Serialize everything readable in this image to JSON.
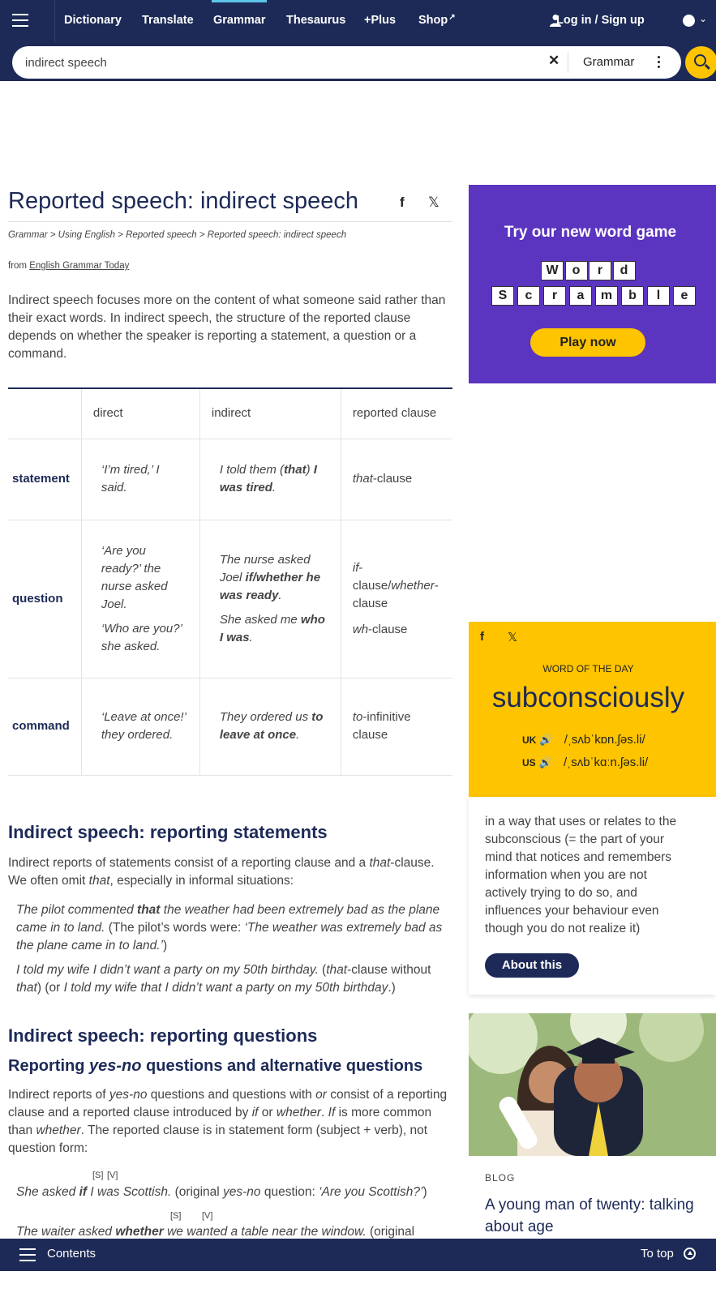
{
  "nav": {
    "items": [
      {
        "label": "Dictionary"
      },
      {
        "label": "Translate"
      },
      {
        "label": "Grammar"
      },
      {
        "label": "Thesaurus"
      },
      {
        "label": "+Plus"
      },
      {
        "label": "Shop"
      }
    ],
    "active": "Grammar",
    "login": "Log in / Sign up"
  },
  "search": {
    "value": "indirect speech",
    "dictionary": "Grammar"
  },
  "article": {
    "title": "Reported speech: indirect speech",
    "breadcrumb": "Grammar > Using English > Reported speech > Reported speech: indirect speech",
    "from_prefix": "from",
    "from_link": "English Grammar Today",
    "intro": "Indirect speech focuses more on the content of what someone said rather than their exact words. In indirect speech, the structure of the reported clause depends on whether the speaker is reporting a statement, a question or a command.",
    "table": {
      "headers": [
        "",
        "direct",
        "indirect",
        "reported clause"
      ],
      "rows": [
        {
          "type": "statement",
          "direct": [
            "‘I’m tired,’ I said."
          ],
          "indirect_pre": "I told them (",
          "indirect_bold1": "that",
          "indirect_mid": ") ",
          "indirect_bold2": "I was tired",
          "indirect_post": ".",
          "reported_1_it": "that",
          "reported_1": "-clause"
        },
        {
          "type": "question",
          "direct": [
            "‘Are you ready?’ the nurse asked Joel.",
            "‘Who are you?’ she asked."
          ],
          "indirect_a_pre": "The nurse asked Joel ",
          "indirect_a_bold": "if/whether he was ready",
          "indirect_a_post": ".",
          "indirect_b_pre": "She asked me ",
          "indirect_b_bold": "who I was",
          "indirect_b_post": ".",
          "reported_1_it": "if",
          "reported_1": "-clause/",
          "reported_1_it2": "whether",
          "reported_1_end": "-clause",
          "reported_2_it": "wh",
          "reported_2": "-clause"
        },
        {
          "type": "command",
          "direct": [
            "‘Leave at once!’ they ordered."
          ],
          "indirect_pre": "They ordered us ",
          "indirect_bold": "to leave at once",
          "indirect_post": ".",
          "reported_1_it": "to",
          "reported_1": "-infinitive clause"
        }
      ]
    },
    "statements": {
      "heading": "Indirect speech: reporting statements",
      "para_1": "Indirect reports of statements consist of a reporting clause and a ",
      "para_it1": "that",
      "para_2": "-clause. We often omit ",
      "para_it2": "that",
      "para_3": ", especially in informal situations:",
      "ex1_it1": "The pilot commented ",
      "ex1_b": "that",
      "ex1_it2": " the weather had been extremely bad as the plane came in to land.",
      "ex1_note1": " (The pilot’s words were: ",
      "ex1_it3": "‘The weather was extremely bad as the plane came in to land.’",
      "ex1_note2": ")",
      "ex2_it1": "I told my wife I didn’t want a party on my 50th birthday.",
      "ex2_n1": " (",
      "ex2_it2": "that",
      "ex2_n2": "-clause without ",
      "ex2_it3": "that",
      "ex2_n3": ") (or ",
      "ex2_it4": "I told my wife that I didn’t want a party on my 50th birthday",
      "ex2_n4": ".)"
    },
    "questions": {
      "heading": "Indirect speech: reporting questions",
      "subheading_1": "Reporting ",
      "subheading_it": "yes-no",
      "subheading_2": " questions and alternative questions",
      "p1": "Indirect reports of ",
      "p_it1": "yes-no",
      "p2": " questions and questions with ",
      "p_it2": "or",
      "p3": " consist of a reporting clause and a reported clause introduced by ",
      "p_it3": "if",
      "p4": " or ",
      "p_it4": "whether",
      "p5": ". ",
      "p_it5": "If",
      "p6": " is more common than ",
      "p_it6": "whether",
      "p7": ". The reported clause is in statement form (subject + verb), not question form:",
      "sv_s": "[S]",
      "sv_v": "[V]",
      "ex1_it1": "She asked ",
      "ex1_b": "if",
      "ex1_it2": " I was Scottish.",
      "ex1_n1": " (original ",
      "ex1_it3": "yes-no",
      "ex1_n2": " question: ",
      "ex1_it4": "‘Are you Scottish?’",
      "ex1_n3": ")",
      "ex2_it1": "The waiter asked ",
      "ex2_b": "whether",
      "ex2_it2": " we wanted a table near the window.",
      "ex2_n1": " (original"
    }
  },
  "promo": {
    "title": "Try our new word game",
    "word1": [
      "W",
      "o",
      "r",
      "d"
    ],
    "word2": [
      "S",
      "c",
      "r",
      "a",
      "m",
      "b",
      "l",
      "e"
    ],
    "button": "Play now",
    "bg": "#5b34c0"
  },
  "wotd": {
    "label": "WORD OF THE DAY",
    "word": "subconsciously",
    "uk_label": "UK",
    "uk_pron": "/ˌsʌbˈkɒn.ʃəs.li/",
    "us_label": "US",
    "us_pron": "/ˌsʌbˈkɑːn.ʃəs.li/",
    "definition": "in a way that uses or relates to the subconscious (= the part of your mind that notices and remembers information when you are not actively trying to do so, and influences your behaviour even though you do not realize it)",
    "button": "About this",
    "bg": "#fec400"
  },
  "blog": {
    "kicker": "BLOG",
    "title": "A young man of twenty: talking about age"
  },
  "bottom": {
    "contents": "Contents",
    "to_top": "To top"
  },
  "colors": {
    "brand_navy": "#1d2a57",
    "accent_yellow": "#fec400",
    "active_tab": "#5ec5e8"
  }
}
